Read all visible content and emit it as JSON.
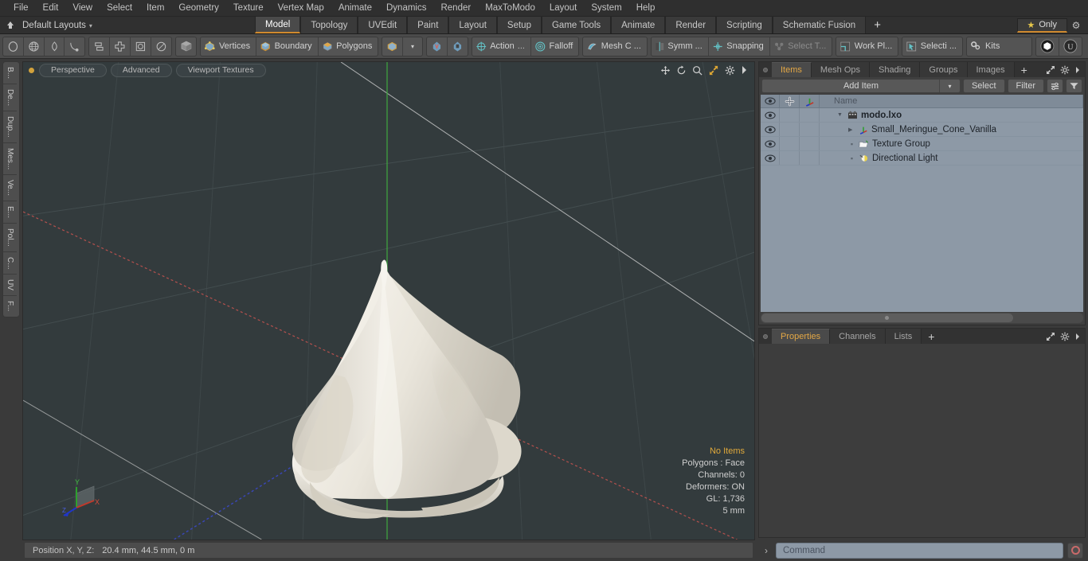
{
  "menubar": {
    "items": [
      "File",
      "Edit",
      "View",
      "Select",
      "Item",
      "Geometry",
      "Texture",
      "Vertex Map",
      "Animate",
      "Dynamics",
      "Render",
      "MaxToModo",
      "Layout",
      "System",
      "Help"
    ]
  },
  "layoutbar": {
    "home_icon": "home-icon",
    "layout_name": "Default Layouts",
    "caret": "▾",
    "tabs": [
      {
        "label": "Model",
        "active": true
      },
      {
        "label": "Topology",
        "active": false
      },
      {
        "label": "UVEdit",
        "active": false
      },
      {
        "label": "Paint",
        "active": false
      },
      {
        "label": "Layout",
        "active": false
      },
      {
        "label": "Setup",
        "active": false
      },
      {
        "label": "Game Tools",
        "active": false
      },
      {
        "label": "Animate",
        "active": false
      },
      {
        "label": "Render",
        "active": false
      },
      {
        "label": "Scripting",
        "active": false
      },
      {
        "label": "Schematic Fusion",
        "active": false
      }
    ],
    "add_tab": "+",
    "only_label": "Only",
    "star_icon": "star-icon",
    "gear_icon": "gear-icon",
    "accent": "#d08a2e"
  },
  "toolbar": {
    "shape_tools": [
      "circle-icon",
      "globe-icon",
      "pen-icon",
      "curve-icon"
    ],
    "align_tools": [
      "align-icon",
      "center-icon",
      "square-icon",
      "ellipse-icon"
    ],
    "cube_icon": "cube-icon",
    "selection_modes": [
      {
        "label": "Vertices",
        "icon": "vertices-icon"
      },
      {
        "label": "Boundary",
        "icon": "boundary-icon"
      },
      {
        "label": "Polygons",
        "icon": "polygons-icon"
      }
    ],
    "item_mode_icon": "item-cube-icon",
    "item_dropdown": "▾",
    "pivot_icons": [
      "pivot-a-icon",
      "pivot-b-icon"
    ],
    "action_label": "Action",
    "action_ellipsis": "...",
    "falloff_label": "Falloff",
    "meshc_label": "Mesh C ...",
    "symm_label": "Symm ...",
    "snapping_label": "Snapping",
    "select_through_label": "Select T...",
    "workplane_label": "Work Pl...",
    "selection_label": "Selecti ...",
    "kits_label": "Kits",
    "modo_icon": "modo-logo-icon",
    "unreal_icon": "unreal-logo-icon"
  },
  "left_tabs": [
    "B...",
    "De...",
    "Dup...",
    "Mes...",
    "Ve...",
    "E...",
    "Pol...",
    "C...",
    "UV",
    "F..."
  ],
  "viewport": {
    "dot": "active-dot",
    "pills": [
      "Perspective",
      "Advanced",
      "Viewport Textures"
    ],
    "header_icons": [
      "move-icon",
      "rotate-icon",
      "zoom-icon",
      "fit-icon",
      "gear-icon",
      "chevron-right-icon"
    ],
    "stats": {
      "title": "No Items",
      "lines": [
        "Polygons : Face",
        "Channels: 0",
        "Deformers: ON",
        "GL: 1,736",
        "5 mm"
      ]
    },
    "axis_labels": {
      "x": "X",
      "y": "Y",
      "z": "Z"
    },
    "background": "#333b3d",
    "model_name": "meringue-cone-mesh",
    "model_color": "#efece4"
  },
  "statusbar": {
    "position_label": "Position X, Y, Z:",
    "position_value": "20.4 mm, 44.5 mm, 0 m"
  },
  "items_panel": {
    "tabs": [
      {
        "label": "Items",
        "active": true
      },
      {
        "label": "Mesh Ops",
        "active": false
      },
      {
        "label": "Shading",
        "active": false
      },
      {
        "label": "Groups",
        "active": false
      },
      {
        "label": "Images",
        "active": false
      }
    ],
    "add_tab": "+",
    "header_icons": [
      "expand-icon",
      "gear-icon",
      "chevron-right-icon"
    ],
    "add_item_label": "Add Item",
    "add_item_caret": "▾",
    "select_label": "Select",
    "filter_label": "Filter",
    "list_icon": "list-options-icon",
    "funnel_icon": "funnel-icon",
    "columns": [
      "eye-icon",
      "lock-icon",
      "axis-icon",
      "Name"
    ],
    "rows": [
      {
        "name": "modo.lxo",
        "icon": "scene-icon",
        "depth": 0,
        "expander": "▼",
        "bold": true,
        "eye": true
      },
      {
        "name": "Small_Meringue_Cone_Vanilla",
        "icon": "mesh-axis-icon",
        "depth": 1,
        "expander": "▶",
        "bold": false,
        "eye": true
      },
      {
        "name": "Texture Group",
        "icon": "texture-group-icon",
        "depth": 1,
        "expander": "",
        "bold": false,
        "eye": true
      },
      {
        "name": "Directional Light",
        "icon": "light-icon",
        "depth": 1,
        "expander": "",
        "bold": false,
        "eye": true
      }
    ]
  },
  "properties_panel": {
    "tabs": [
      {
        "label": "Properties",
        "active": true
      },
      {
        "label": "Channels",
        "active": false
      },
      {
        "label": "Lists",
        "active": false
      }
    ],
    "add_tab": "+",
    "header_icons": [
      "expand-icon",
      "gear-icon",
      "chevron-right-icon"
    ]
  },
  "command_bar": {
    "caret": "›",
    "placeholder": "Command",
    "record_icon": "record-icon"
  }
}
